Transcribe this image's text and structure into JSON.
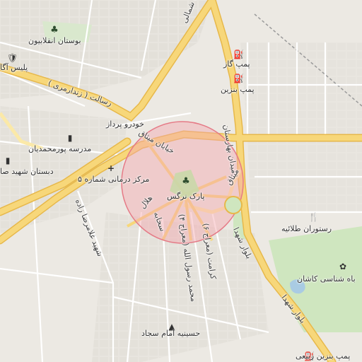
{
  "map": {
    "labels": {
      "boulevard_north": "بلوار ملک شمالی",
      "boostan": "بوستان انقلابیون",
      "police": "پلیس آگا",
      "resalat": "رسالت ( زندارمری )",
      "khodro": "خودرو پرداز",
      "madreseh": "مدرسه پورمحمدیان",
      "dabestan": "دبستان شهید صا",
      "markaz": "مرکز درمانی شماره ۵",
      "park": "پارک نرگس",
      "kheyaban_mitaq": "خیابان میثاق",
      "midan_baharestan": "میدان بهارستان",
      "bolvar_shohada": "بلوار شهدا",
      "bolvar_shohada_2": "بلوار شهدا",
      "pomp_gas": "پمپ گاز",
      "pomp_benzin": "پمپ بنزین",
      "resturan": "رستوران طلائیه",
      "zist": "باه شناسی کاشان",
      "hosseinieh": "حسینیه امام سجاد",
      "pomp_rabiei": "پمپ بنزین ربیعی",
      "shahid_gholamreza": "شهید غلامرضا زاده",
      "helal": "هلال",
      "sahab": "سحابه",
      "mohammad_rasul": "محمد رسول الله (معراج ۴)",
      "karamat": "کرامت (معراج ۶)",
      "mitaq_short": "میثاق"
    },
    "icons": {
      "tree": "tree-icon",
      "police": "police-icon",
      "school": "school-icon",
      "hospital": "hospital-icon",
      "fuel": "fuel-icon",
      "restaurant": "restaurant-icon",
      "mosque": "mosque-icon",
      "parking": "parking-icon",
      "park_icon": "park-icon"
    },
    "colors": {
      "background": "#ece9e3",
      "major_road": "#f7d77a",
      "major_road_casing": "#e7b84a",
      "minor_road": "#ffffff",
      "green": "#cfe6bf",
      "water": "#a9cbe3",
      "circle_fill": "#f4a7ae",
      "circle_stroke": "#e57a86",
      "railway": "#9a9a9a"
    }
  }
}
